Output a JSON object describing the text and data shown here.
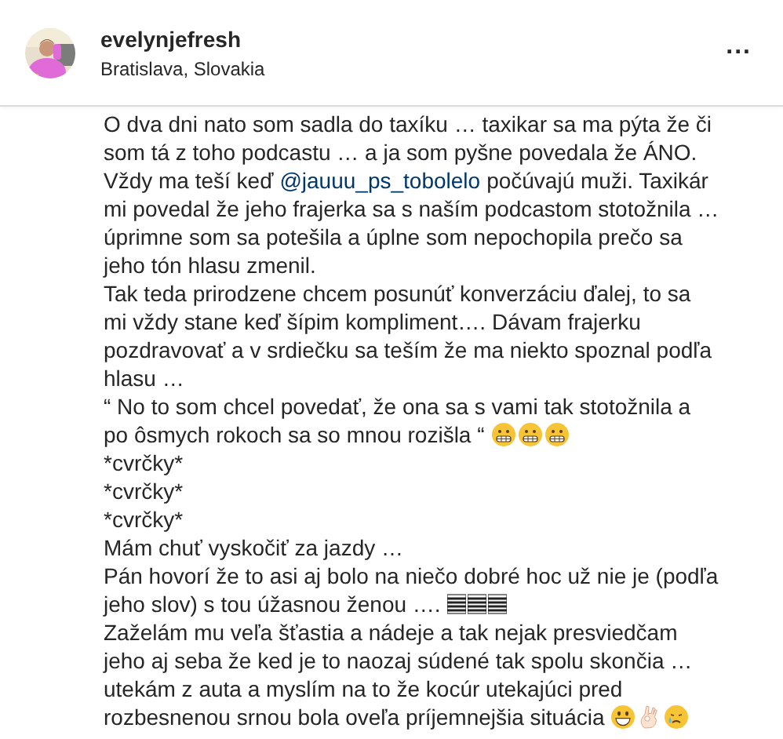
{
  "header": {
    "username": "evelynjefresh",
    "location": "Bratislava, Slovakia",
    "more": "..."
  },
  "caption_lines": [
    {
      "parts": [
        {
          "kind": "text",
          "text": "O dva dni nato som sadla do taxíku … taxikar sa ma pýta že či"
        }
      ]
    },
    {
      "parts": [
        {
          "kind": "text",
          "text": "som tá z toho podcastu … a ja som pyšne povedala že ÁNO."
        }
      ]
    },
    {
      "parts": [
        {
          "kind": "text",
          "text": "Vždy ma teší keď"
        },
        {
          "kind": "mention",
          "text": "@jauuu_ps_tobolelo"
        },
        {
          "kind": "text",
          "text": "počúvajú muži. Taxikár"
        }
      ]
    },
    {
      "parts": [
        {
          "kind": "text",
          "text": "mi povedal že jeho frajerka sa s naším podcastom stotožnila …"
        }
      ]
    },
    {
      "parts": [
        {
          "kind": "text",
          "text": "úprimne som sa potešila a úplne som nepochopila prečo sa"
        }
      ]
    },
    {
      "parts": [
        {
          "kind": "text",
          "text": "jeho tón hlasu zmenil."
        }
      ]
    },
    {
      "parts": [
        {
          "kind": "text",
          "text": "Tak teda prirodzene chcem posunúť konverzáciu ďalej, to sa"
        }
      ]
    },
    {
      "parts": [
        {
          "kind": "text",
          "text": "mi vždy stane keď šípim kompliment…. Dávam frajerku"
        }
      ]
    },
    {
      "parts": [
        {
          "kind": "text",
          "text": "pozdravovať a v srdiečku sa teším že ma niekto spoznal podľa"
        }
      ]
    },
    {
      "parts": [
        {
          "kind": "text",
          "text": "hlasu …"
        }
      ]
    },
    {
      "parts": [
        {
          "kind": "text",
          "text": "“ No to som chcel povedať, že ona sa s vami tak stotožnila a"
        }
      ]
    },
    {
      "parts": [
        {
          "kind": "text",
          "text": "po ôsmych rokoch sa so mnou rozišla “"
        },
        {
          "kind": "grimace"
        },
        {
          "kind": "grimace"
        },
        {
          "kind": "grimace"
        }
      ]
    },
    {
      "parts": [
        {
          "kind": "text",
          "text": "*cvrčky*"
        }
      ]
    },
    {
      "parts": [
        {
          "kind": "text",
          "text": "*cvrčky*"
        }
      ]
    },
    {
      "parts": [
        {
          "kind": "text",
          "text": "*cvrčky*"
        }
      ]
    },
    {
      "parts": [
        {
          "kind": "text",
          "text": "Mám chuť vyskočiť za jazdy …"
        }
      ]
    },
    {
      "parts": [
        {
          "kind": "text",
          "text": "Pán hovorí že to asi aj bolo na niečo dobré hoc už nie je (podľa"
        }
      ]
    },
    {
      "parts": [
        {
          "kind": "text",
          "text": "jeho slov) s tou úžasnou ženou …."
        },
        {
          "kind": "bars"
        },
        {
          "kind": "bars"
        },
        {
          "kind": "bars"
        }
      ]
    },
    {
      "parts": [
        {
          "kind": "text",
          "text": "Zaželám mu veľa šťastia a nádeje a tak nejak presviedčam"
        }
      ]
    },
    {
      "parts": [
        {
          "kind": "text",
          "text": "jeho aj seba že ked je to naozaj súdené tak spolu skončia …"
        }
      ]
    },
    {
      "parts": [
        {
          "kind": "text",
          "text": "utekám z auta a myslím na to že kocúr utekajúci pred"
        }
      ]
    },
    {
      "parts": [
        {
          "kind": "text",
          "text": "rozbesnenou srnou bola oveľa príjemnejšia situácia"
        },
        {
          "kind": "grin"
        },
        {
          "kind": "ok"
        },
        {
          "kind": "cry"
        }
      ]
    }
  ]
}
